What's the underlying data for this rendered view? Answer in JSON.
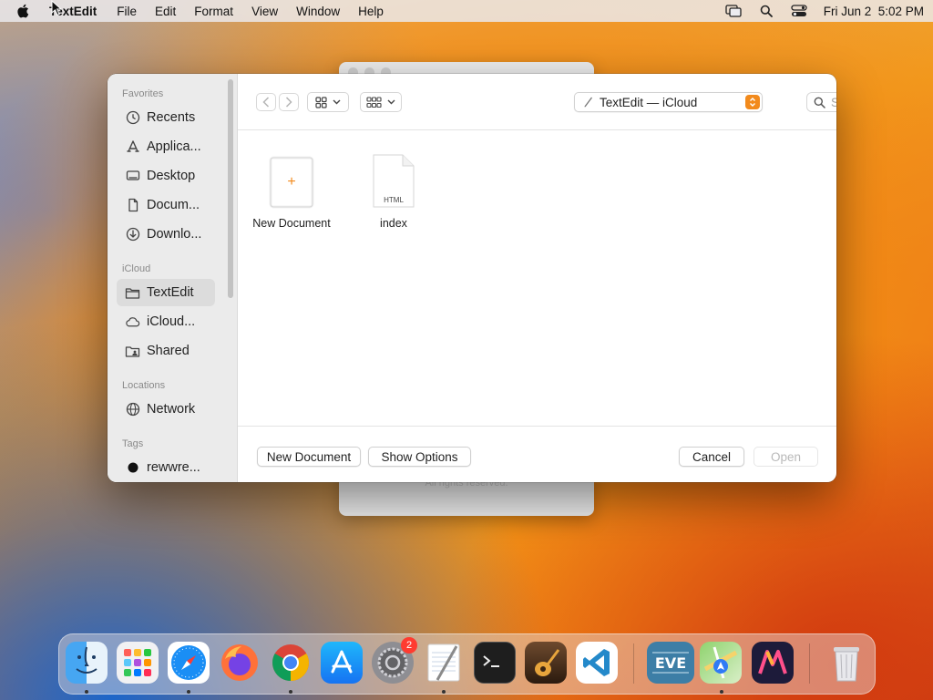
{
  "menubar": {
    "app_name": "TextEdit",
    "items": [
      "File",
      "Edit",
      "Format",
      "View",
      "Window",
      "Help"
    ],
    "datetime": "Fri Jun 2  5:02 PM"
  },
  "background_window": {
    "rights_text": "All rights reserved."
  },
  "sidebar": {
    "favorites_heading": "Favorites",
    "favorites": [
      "Recents",
      "Applica...",
      "Desktop",
      "Docum...",
      "Downlo..."
    ],
    "icloud_heading": "iCloud",
    "icloud": [
      "TextEdit",
      "iCloud...",
      "Shared"
    ],
    "locations_heading": "Locations",
    "locations": [
      "Network"
    ],
    "tags_heading": "Tags",
    "tags": [
      "rewwre..."
    ]
  },
  "toolbar": {
    "location": "TextEdit — iCloud",
    "search_placeholder": "Search"
  },
  "files": [
    {
      "name": "New Document",
      "badge": "+"
    },
    {
      "name": "index",
      "type": "HTML"
    }
  ],
  "footer": {
    "new_document": "New Document",
    "show_options": "Show Options",
    "cancel": "Cancel",
    "open": "Open"
  },
  "dock": {
    "badge_count": "2",
    "apps": [
      "finder-icon",
      "launchpad-icon",
      "safari-icon",
      "firefox-icon",
      "chrome-icon",
      "app-store-icon",
      "system-settings-icon",
      "textedit-icon",
      "terminal-icon",
      "garageband-icon",
      "vscode-icon",
      "eve-icon",
      "maps-icon",
      "mochi-icon",
      "trash-icon"
    ]
  },
  "colors": {
    "accent": "#f28a1c",
    "selection": "#dcdcdc"
  }
}
